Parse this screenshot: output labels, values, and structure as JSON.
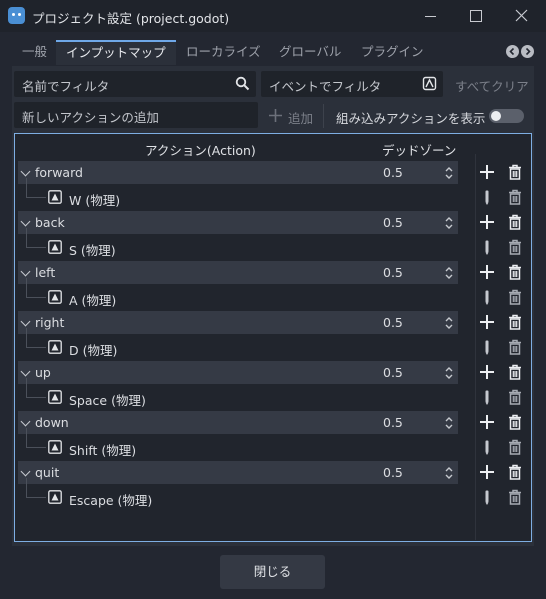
{
  "window": {
    "title": "プロジェクト設定 (project.godot)"
  },
  "tabs": [
    "一般",
    "インプットマップ",
    "ローカライズ",
    "グローバル",
    "プラグイン"
  ],
  "active_tab_index": 1,
  "filters": {
    "name_placeholder": "名前でフィルタ",
    "event_placeholder": "イベントでフィルタ",
    "clear_all": "すべてクリア"
  },
  "add_action": {
    "placeholder": "新しいアクションの追加",
    "add_label": "追加",
    "builtin_label": "組み込みアクションを表示",
    "builtin_enabled": false
  },
  "columns": {
    "action": "アクション(Action)",
    "deadzone": "デッドゾーン"
  },
  "actions": [
    {
      "name": "forward",
      "deadzone": "0.5",
      "event": "W (物理)"
    },
    {
      "name": "back",
      "deadzone": "0.5",
      "event": "S (物理)"
    },
    {
      "name": "left",
      "deadzone": "0.5",
      "event": "A (物理)"
    },
    {
      "name": "right",
      "deadzone": "0.5",
      "event": "D (物理)"
    },
    {
      "name": "up",
      "deadzone": "0.5",
      "event": "Space (物理)"
    },
    {
      "name": "down",
      "deadzone": "0.5",
      "event": "Shift (物理)"
    },
    {
      "name": "quit",
      "deadzone": "0.5",
      "event": "Escape (物理)"
    }
  ],
  "footer": {
    "close_label": "閉じる"
  },
  "colors": {
    "accent": "#7eaee3",
    "background": "#232731",
    "panel": "#2b303a"
  },
  "icons": {
    "app": "godot-icon",
    "search": "search-icon",
    "event_listen": "event-listen-icon",
    "add": "plus-icon",
    "delete": "trash-icon",
    "edit": "edit-icon",
    "key": "key-icon"
  }
}
